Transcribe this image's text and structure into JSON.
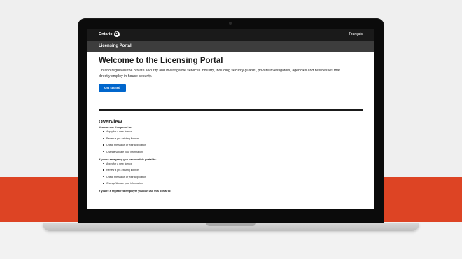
{
  "site": {
    "brand": "Ontario",
    "language_toggle": "Français",
    "portal_title": "Licensing Portal"
  },
  "main": {
    "heading": "Welcome to the Licensing Portal",
    "intro": "Ontario regulates the private security and investigative services industry, including security guards, private investigators, agencies and businesses that directly employ in-house security.",
    "cta_label": "Get started"
  },
  "overview": {
    "heading": "Overview",
    "groups": [
      {
        "title": "You can use this portal to:",
        "items": [
          "Apply for a new licence",
          "Renew a pre-existing licence",
          "Check the status of your application",
          "Change/Update your information"
        ]
      },
      {
        "title": "If you're an agency you can use this portal to:",
        "items": [
          "Apply for a new licence",
          "Renew a pre-existing licence",
          "Check the status of your application",
          "Change/Update your information"
        ]
      },
      {
        "title": "If you're a registered employer you can use this portal to:",
        "items": []
      }
    ]
  },
  "colors": {
    "background_red": "#dd4424",
    "header_dark": "#1a1a1a",
    "portal_bar": "#3d3d3d",
    "button_blue": "#0066cc"
  },
  "icons": {
    "brand_logo": "trillium-logo-icon"
  }
}
